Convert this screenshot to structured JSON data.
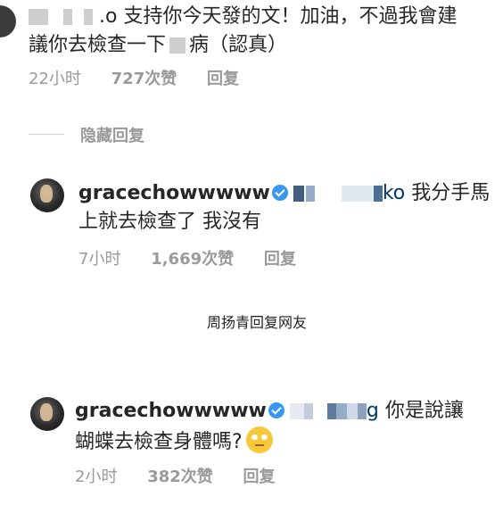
{
  "comment1": {
    "line1": ".o 支持你今天發的文！加油，不過我會建",
    "line2_a": "議你去檢查一下",
    "line2_b": "病（認真）",
    "time": "22小时",
    "likes": "727次赞",
    "reply": "回复"
  },
  "hide_replies": "隐藏回复",
  "comment2": {
    "username": "gracechowwwww",
    "mention_tail": "ko",
    "text_a": "我分手馬",
    "text_b": "上就去檢查了 我沒有",
    "time": "7小时",
    "likes": "1,669次赞",
    "reply": "回复"
  },
  "caption": "周扬青回复网友",
  "comment3": {
    "username": "gracechowwwww",
    "mention_tail": "g",
    "text_a": "你是說讓",
    "text_b": "蝴蝶去檢查身體嗎?",
    "time": "2小时",
    "likes": "382次赞",
    "reply": "回复"
  },
  "icons": {
    "verified": "verified-badge-icon",
    "emoji": "rolling-eyes-emoji-icon",
    "avatar": "avatar"
  },
  "colors": {
    "verified": "#3897f0",
    "meta_gray": "#9a9a9a",
    "mention": "#00376b"
  }
}
